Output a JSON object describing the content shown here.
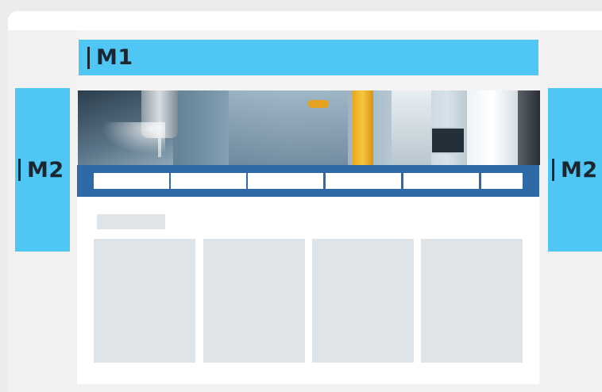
{
  "slots": {
    "top": {
      "label": "M1",
      "color": "#4fc6f3"
    },
    "side_left": {
      "label": "M2",
      "color": "#4fc6f3"
    },
    "side_right": {
      "label": "M2",
      "color": "#4fc6f3"
    }
  },
  "hero": {
    "image": "industrial-machining-photo"
  },
  "nav": {
    "item_count": 6,
    "color": "#2e6aa8"
  },
  "main": {
    "card_count": 4,
    "placeholder_color": "#dfe4e8"
  }
}
